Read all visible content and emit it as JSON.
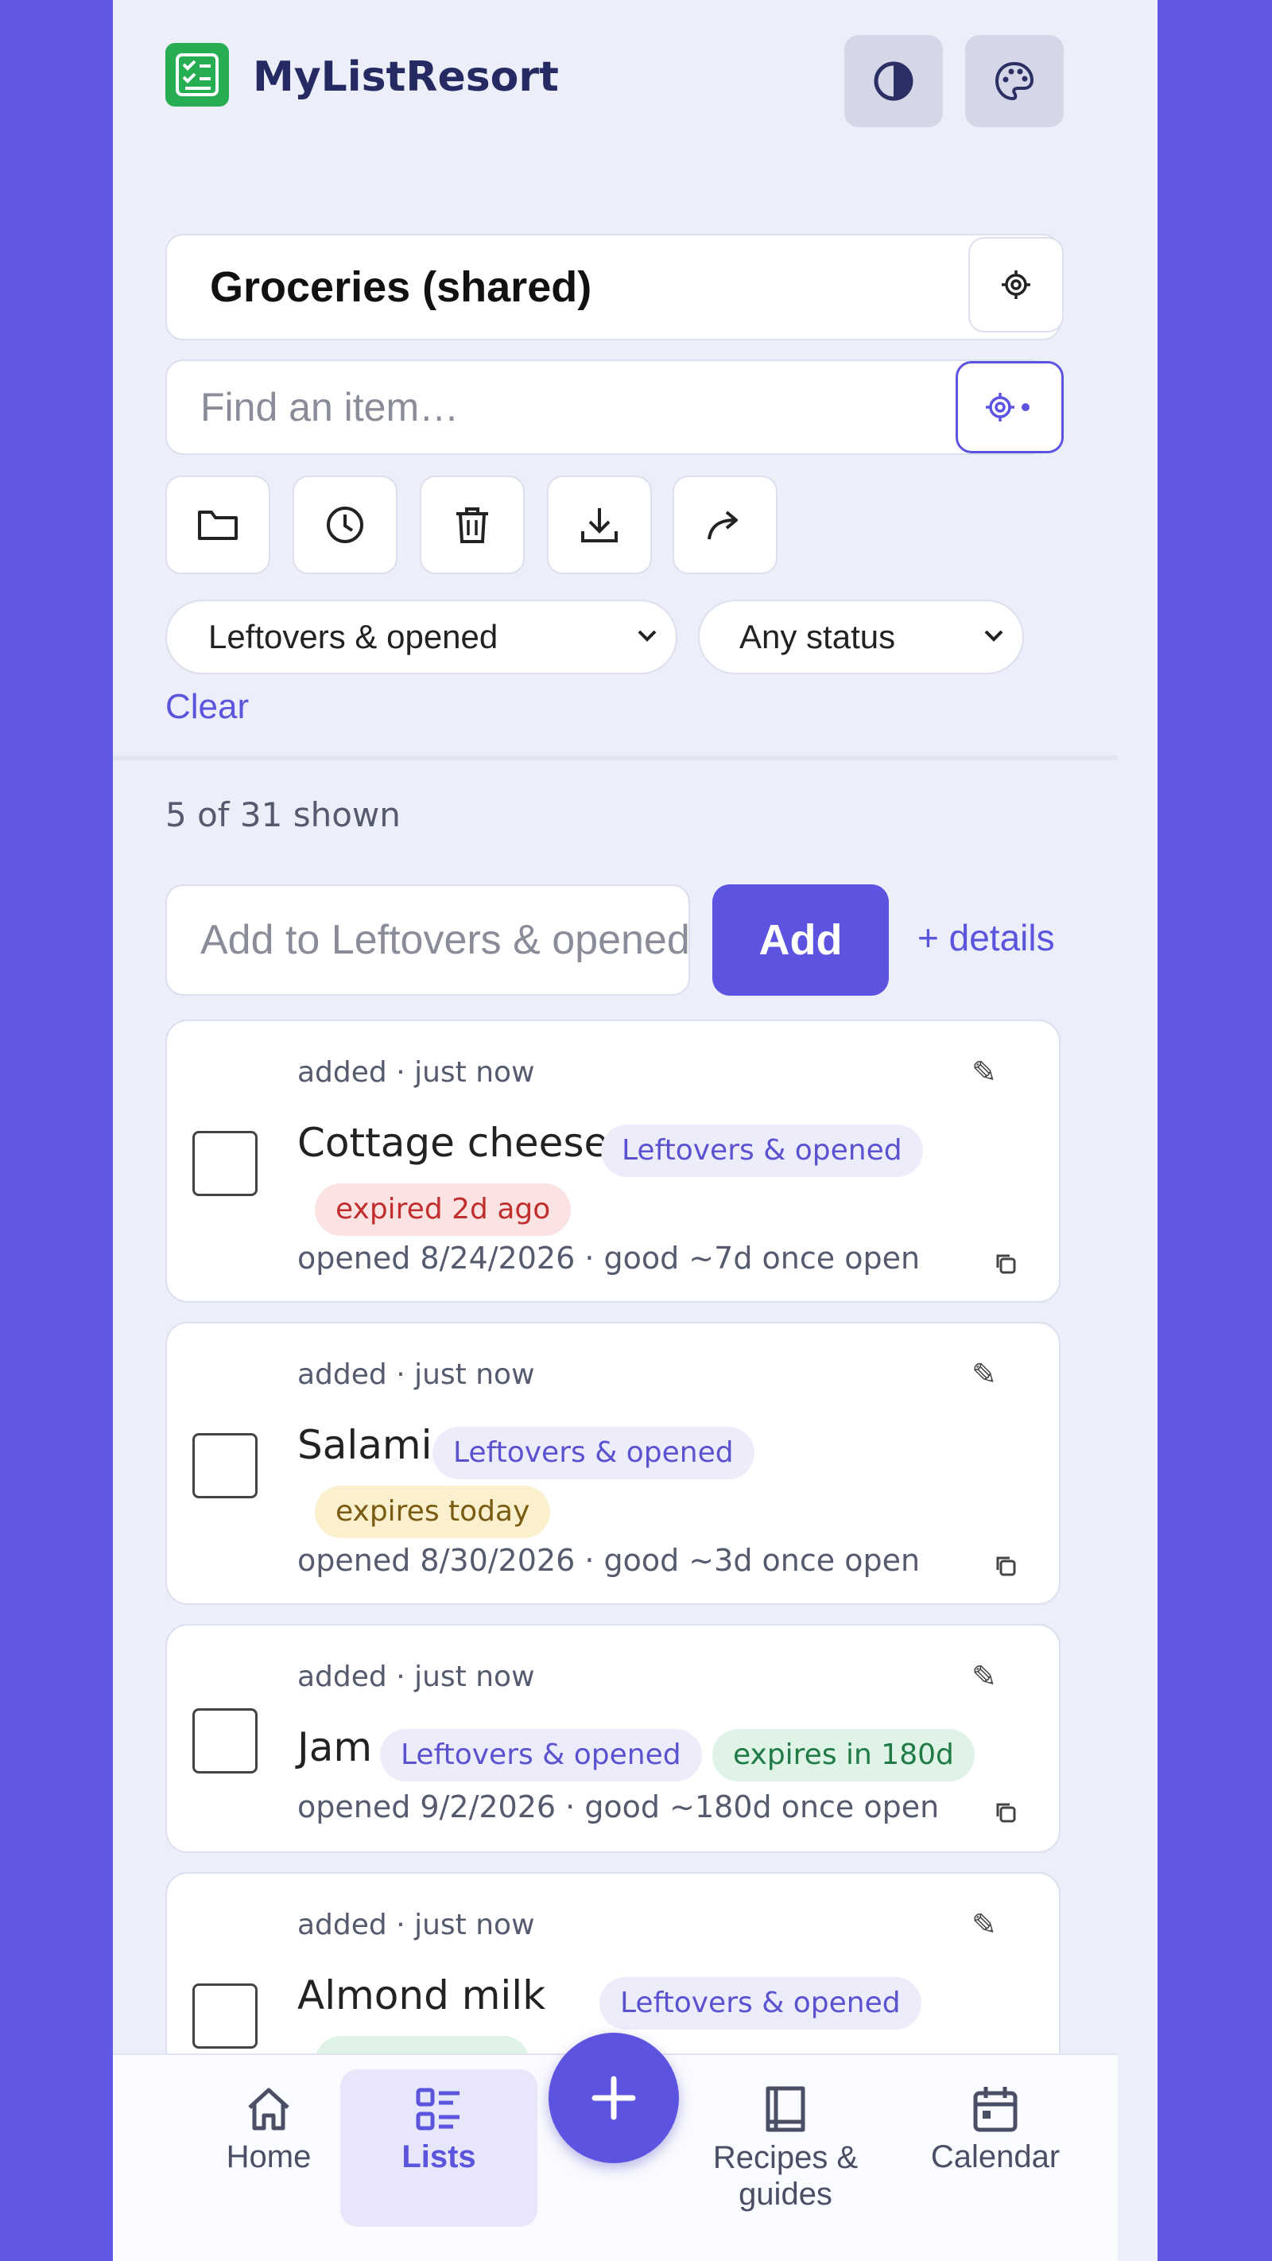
{
  "header": {
    "app_name": "MyListResort",
    "theme_toggle_icon": "contrast-icon",
    "palette_icon": "palette-icon"
  },
  "list_selector": {
    "selected": "Groceries (shared)"
  },
  "search": {
    "placeholder": "Find an item…",
    "value": ""
  },
  "toolbar_icons": [
    "folder-icon",
    "history-icon",
    "trash-icon",
    "download-icon",
    "share-icon"
  ],
  "filters": {
    "category": "Leftovers & opened",
    "status": "Any status",
    "clear_label": "Clear"
  },
  "count_text": "5 of 31 shown",
  "add_row": {
    "placeholder": "Add to Leftovers & opened",
    "add_label": "Add",
    "details_label": "+ details"
  },
  "items": [
    {
      "meta": "added · just now",
      "name": "Cottage cheese",
      "category": "Leftovers & opened",
      "status": "expired 2d ago",
      "status_color": "#c02e2e",
      "sub": "opened 8/24/2026 · good ~7d once open"
    },
    {
      "meta": "added · just now",
      "name": "Salami",
      "category": "Leftovers & opened",
      "status": "expires today",
      "status_color": "#7a5b12",
      "sub": "opened 8/30/2026 · good ~3d once open"
    },
    {
      "meta": "added · just now",
      "name": "Jam",
      "category": "Leftovers & opened",
      "status": "expires in 180d",
      "status_color": "#1f7a45",
      "sub": "opened 9/2/2026 · good ~180d once open"
    },
    {
      "meta": "added · just now",
      "name": "Almond milk",
      "category": "Leftovers & opened"
    }
  ],
  "bottom_nav": [
    {
      "label": "Home",
      "icon": "home-icon"
    },
    {
      "label": "Lists",
      "icon": "list-icon",
      "active": true
    },
    {
      "label": "Recipes & guides",
      "icon": "book-icon"
    },
    {
      "label": "Calendar",
      "icon": "calendar-icon"
    }
  ],
  "fab_icon": "plus-icon",
  "colors": {
    "accent": "#5c53e0",
    "background": "#6158e6",
    "surface": "#eceefa"
  }
}
